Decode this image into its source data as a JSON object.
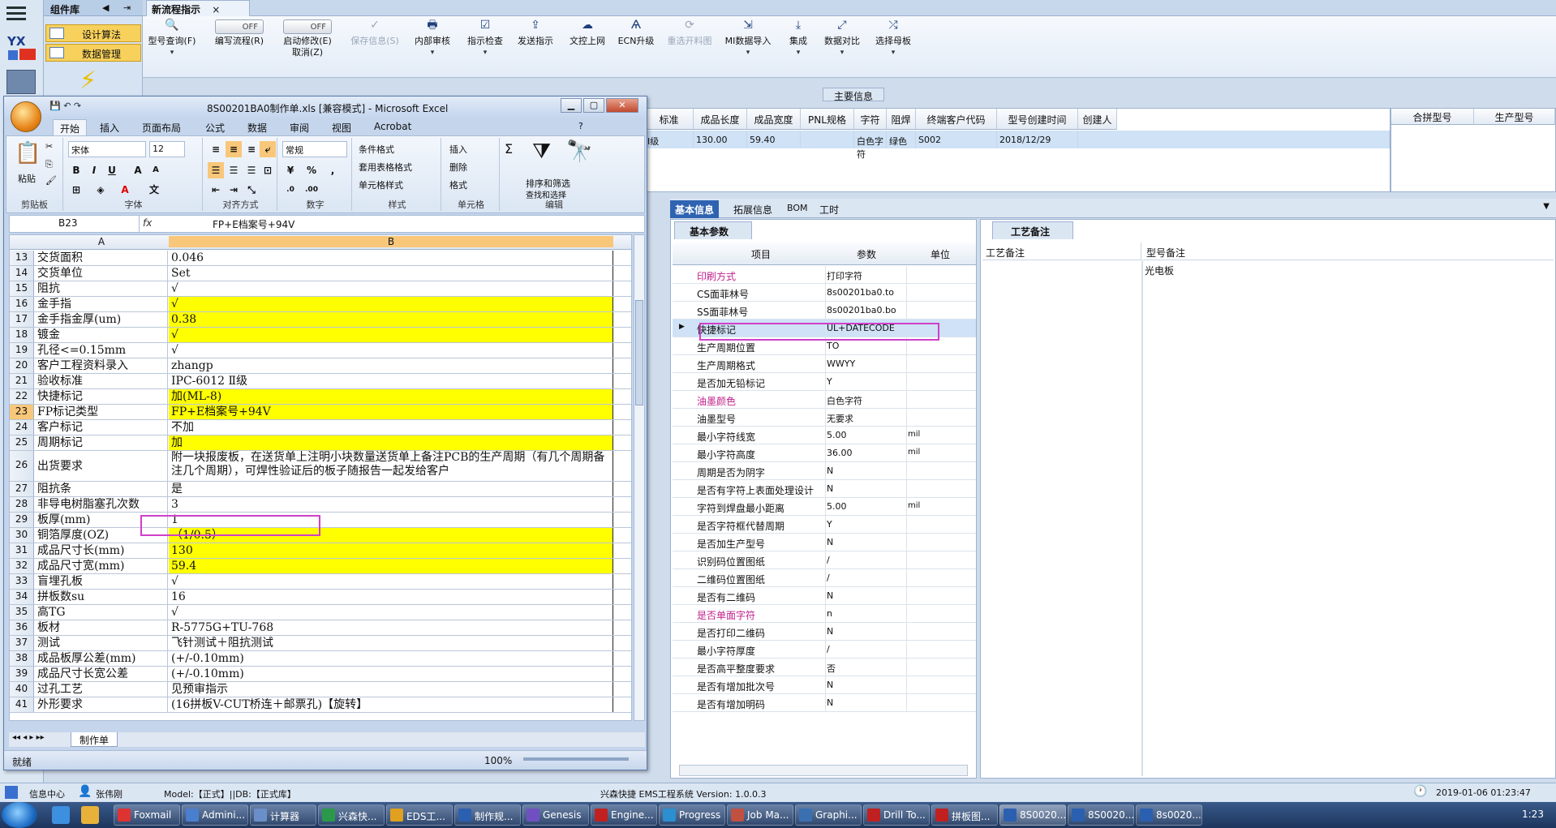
{
  "rail": {
    "logo": "YX"
  },
  "component_panel": {
    "title": "组件库",
    "items": [
      "设计算法",
      "数据管理"
    ]
  },
  "main_tab": {
    "title": "新流程指示",
    "close": "×"
  },
  "ribbon": {
    "buttons": [
      {
        "label": "型号查询(F)",
        "icon": "search-icon"
      },
      {
        "label": "编写流程(R)",
        "toggle": "OFF"
      },
      {
        "label": "启动修改(E)",
        "label2": "取消(Z)",
        "toggle": "OFF"
      },
      {
        "label": "保存信息(S)",
        "icon": "check-icon"
      },
      {
        "label": "内部审核",
        "icon": "printer-icon"
      },
      {
        "label": "指示检查",
        "icon": "checklist-icon"
      },
      {
        "label": "发送指示",
        "icon": "upload-icon"
      },
      {
        "label": "文控上网",
        "icon": "cloud-upload-icon"
      },
      {
        "label": "ECN升级",
        "icon": "ecn-icon"
      },
      {
        "label": "重选开料图",
        "icon": "refresh-icon"
      },
      {
        "label": "MI数据导入",
        "icon": "import-icon"
      },
      {
        "label": "集成",
        "icon": "download-icon"
      },
      {
        "label": "数据对比",
        "icon": "compare-icon"
      },
      {
        "label": "选择母板",
        "icon": "shuffle-icon"
      }
    ]
  },
  "main_info": {
    "label": "主要信息",
    "columns": [
      "标准",
      "成品长度",
      "成品宽度",
      "PNL规格",
      "字符",
      "阻焊",
      "终端客户代码",
      "型号创建时间",
      "创建人"
    ],
    "row": [
      "Ⅰ级",
      "130.00",
      "59.40",
      "",
      "白色字符",
      "绿色",
      "S002",
      "2018/12/29",
      ""
    ],
    "right_columns": [
      "合拼型号",
      "生产型号"
    ]
  },
  "lower_tabs": [
    "基本信息",
    "拓展信息",
    "BOM",
    "工时"
  ],
  "basic_params": {
    "tab": "基本参数",
    "headers": [
      "项目",
      "参数",
      "单位"
    ],
    "rows": [
      {
        "k": "印刷方式",
        "v": "打印字符",
        "u": "",
        "pink": true
      },
      {
        "k": "CS面菲林号",
        "v": "8s00201ba0.to",
        "u": ""
      },
      {
        "k": "SS面菲林号",
        "v": "8s00201ba0.bo",
        "u": ""
      },
      {
        "k": "快捷标记",
        "v": "UL+DATECODE",
        "u": "",
        "sel": true
      },
      {
        "k": "生产周期位置",
        "v": "TO",
        "u": ""
      },
      {
        "k": "生产周期格式",
        "v": "WWYY",
        "u": ""
      },
      {
        "k": "是否加无铅标记",
        "v": "Y",
        "u": ""
      },
      {
        "k": "油墨颜色",
        "v": "白色字符",
        "u": "",
        "pink": true
      },
      {
        "k": "油墨型号",
        "v": "无要求",
        "u": ""
      },
      {
        "k": "最小字符线宽",
        "v": "5.00",
        "u": "mil"
      },
      {
        "k": "最小字符高度",
        "v": "36.00",
        "u": "mil"
      },
      {
        "k": "周期是否为阴字",
        "v": "N",
        "u": ""
      },
      {
        "k": "是否有字符上表面处理设计",
        "v": "N",
        "u": ""
      },
      {
        "k": "字符到焊盘最小距离",
        "v": "5.00",
        "u": "mil"
      },
      {
        "k": "是否字符框代替周期",
        "v": "Y",
        "u": ""
      },
      {
        "k": "是否加生产型号",
        "v": "N",
        "u": ""
      },
      {
        "k": "识别码位置图纸",
        "v": "/",
        "u": ""
      },
      {
        "k": "二维码位置图纸",
        "v": "/",
        "u": ""
      },
      {
        "k": "是否有二维码",
        "v": "N",
        "u": ""
      },
      {
        "k": "是否单面字符",
        "v": "n",
        "u": "",
        "pink": true
      },
      {
        "k": "是否打印二维码",
        "v": "N",
        "u": ""
      },
      {
        "k": "最小字符厚度",
        "v": "/",
        "u": ""
      },
      {
        "k": "是否高平整度要求",
        "v": "否",
        "u": ""
      },
      {
        "k": "是否有增加批次号",
        "v": "N",
        "u": ""
      },
      {
        "k": "是否有增加明码",
        "v": "N",
        "u": ""
      }
    ]
  },
  "craft_notes": {
    "tab": "工艺备注",
    "col1": "工艺备注",
    "col2": "型号备注",
    "value": "光电板"
  },
  "excel": {
    "title": "8S00201BA0制作单.xls  [兼容模式] - Microsoft Excel",
    "tabs": [
      "开始",
      "插入",
      "页面布局",
      "公式",
      "数据",
      "审阅",
      "视图",
      "Acrobat"
    ],
    "ribbon": {
      "paste": "粘贴",
      "clipboard": "剪贴板",
      "font_name": "宋体",
      "font_size": "12",
      "font_group": "字体",
      "align_group": "对齐方式",
      "number_format": "常规",
      "number_group": "数字",
      "style_items": [
        "条件格式",
        "套用表格格式",
        "单元格样式"
      ],
      "style_group": "样式",
      "cell_items": [
        "插入",
        "删除",
        "格式"
      ],
      "cell_group": "单元格",
      "edit_items": [
        "排序和筛选",
        "查找和选择"
      ],
      "edit_group": "编辑"
    },
    "name_box": "B23",
    "formula": "FP+E档案号+94V",
    "col_a": "A",
    "col_b": "B",
    "rows": [
      {
        "n": "13",
        "a": "交货面积",
        "b": "0.046",
        "y": false
      },
      {
        "n": "14",
        "a": "交货单位",
        "b": "Set",
        "y": false
      },
      {
        "n": "15",
        "a": "阻抗",
        "b": "√",
        "y": false
      },
      {
        "n": "16",
        "a": "金手指",
        "b": "√",
        "y": true
      },
      {
        "n": "17",
        "a": "金手指金厚(um)",
        "b": "0.38",
        "y": true
      },
      {
        "n": "18",
        "a": "镀金",
        "b": "√",
        "y": true
      },
      {
        "n": "19",
        "a": "孔径<=0.15mm",
        "b": "√",
        "y": false
      },
      {
        "n": "20",
        "a": "客户工程资料录入",
        "b": "zhangp",
        "y": false
      },
      {
        "n": "21",
        "a": "验收标准",
        "b": "IPC-6012 Ⅱ级",
        "y": false
      },
      {
        "n": "22",
        "a": "快捷标记",
        "b": "加(ML-8)",
        "y": true
      },
      {
        "n": "23",
        "a": "FP标记类型",
        "b": "FP+E档案号+94V",
        "y": true,
        "sel": true
      },
      {
        "n": "24",
        "a": "客户标记",
        "b": "不加",
        "y": false
      },
      {
        "n": "25",
        "a": "周期标记",
        "b": "加",
        "y": true
      },
      {
        "n": "26",
        "a": "出货要求",
        "b": "附一块报废板，在送货单上注明小块数量送货单上备注PCB的生产周期（有几个周期备注几个周期），可焊性验证后的板子随报告一起发给客户",
        "y": false,
        "tall": true
      },
      {
        "n": "27",
        "a": "阻抗条",
        "b": "是",
        "y": false
      },
      {
        "n": "28",
        "a": "非导电树脂塞孔次数",
        "b": "3",
        "y": false
      },
      {
        "n": "29",
        "a": "板厚(mm)",
        "b": "1",
        "y": false
      },
      {
        "n": "30",
        "a": "铜箔厚度(OZ)",
        "b": "（1/0.5）",
        "y": true
      },
      {
        "n": "31",
        "a": "成品尺寸长(mm)",
        "b": "130",
        "y": true
      },
      {
        "n": "32",
        "a": "成品尺寸宽(mm)",
        "b": "59.4",
        "y": true
      },
      {
        "n": "33",
        "a": "盲埋孔板",
        "b": "√",
        "y": false
      },
      {
        "n": "34",
        "a": "拼板数su",
        "b": "16",
        "y": false
      },
      {
        "n": "35",
        "a": "高TG",
        "b": "√",
        "y": false
      },
      {
        "n": "36",
        "a": "板材",
        "b": "R-5775G+TU-768",
        "y": false
      },
      {
        "n": "37",
        "a": "测试",
        "b": "飞针测试＋阻抗测试",
        "y": false
      },
      {
        "n": "38",
        "a": "成品板厚公差(mm)",
        "b": "(+/-0.10mm)",
        "y": false
      },
      {
        "n": "39",
        "a": "成品尺寸长宽公差",
        "b": "(+/-0.10mm)",
        "y": false
      },
      {
        "n": "40",
        "a": "过孔工艺",
        "b": "见预审指示",
        "y": false
      },
      {
        "n": "41",
        "a": "外形要求",
        "b": "(16拼板V-CUT桥连＋邮票孔)【旋转】",
        "y": false
      }
    ],
    "sheet_tab": "制作单",
    "status": "就绪",
    "zoom": "100%"
  },
  "app_status": {
    "info_center": "信息中心",
    "user": "张伟刚",
    "model": "Model:【正式】||DB:【正式库】",
    "system": "兴森快捷 EMS工程系统 Version: 1.0.0.3",
    "datetime": "2019-01-06 01:23:47"
  },
  "taskbar": {
    "items": [
      "Foxmail",
      "Admini...",
      "计算器",
      "兴森快...",
      "EDS工...",
      "制作规...",
      "Genesis",
      "Engine...",
      "Progress",
      "Job Ma...",
      "Graphi...",
      "Drill To...",
      "拼板图...",
      "8S0020...",
      "8S0020...",
      "8s0020..."
    ],
    "clock": "1:23"
  },
  "colors": {
    "accent": "#2f63b2",
    "highlight": "#d040c8",
    "yellow": "#ffff00",
    "pink_text": "#c0208c"
  }
}
